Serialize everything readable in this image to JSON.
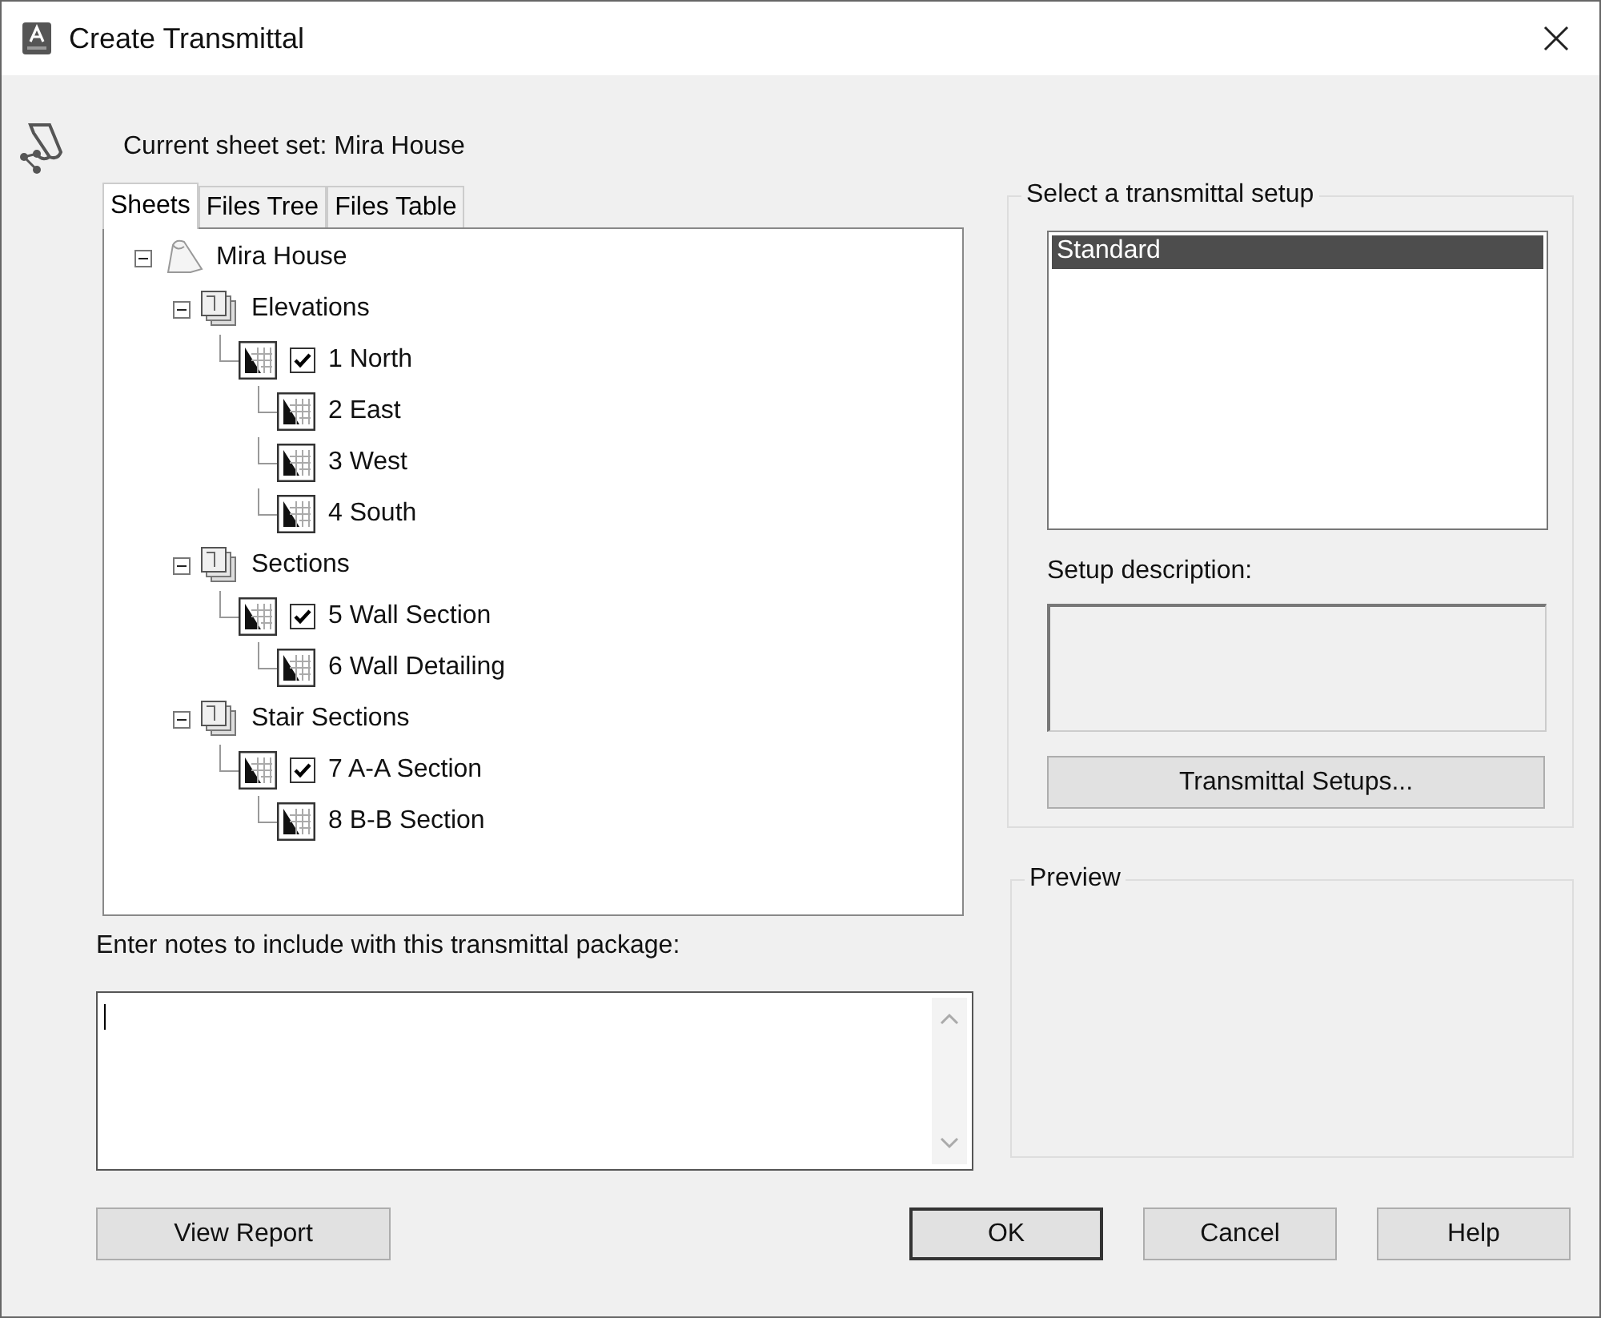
{
  "window": {
    "title": "Create Transmittal"
  },
  "current_sheet_set": "Current sheet set: Mira House",
  "tabs": [
    {
      "label": "Sheets",
      "selected": true
    },
    {
      "label": "Files Tree",
      "selected": false
    },
    {
      "label": "Files Table",
      "selected": false
    }
  ],
  "tree": {
    "root": {
      "label": "Mira House",
      "expanded": true,
      "children": [
        {
          "label": "Elevations",
          "expanded": true,
          "children": [
            {
              "label": "1 North",
              "checked": true,
              "children": [
                {
                  "label": "2 East"
                },
                {
                  "label": "3 West"
                },
                {
                  "label": "4 South"
                }
              ]
            }
          ]
        },
        {
          "label": "Sections",
          "expanded": true,
          "children": [
            {
              "label": "5 Wall Section",
              "checked": true,
              "children": [
                {
                  "label": "6 Wall Detailing"
                }
              ]
            }
          ]
        },
        {
          "label": "Stair Sections",
          "expanded": true,
          "children": [
            {
              "label": "7 A-A Section",
              "checked": true,
              "children": [
                {
                  "label": "8 B-B Section"
                }
              ]
            }
          ]
        }
      ]
    }
  },
  "notes": {
    "label": "Enter notes to include with this transmittal package:"
  },
  "setup": {
    "title": "Select a transmittal setup",
    "items": [
      {
        "label": "Standard",
        "selected": true
      }
    ],
    "description_label": "Setup description:",
    "setups_button": "Transmittal Setups..."
  },
  "preview": {
    "title": "Preview"
  },
  "buttons": {
    "view_report": "View Report",
    "ok": "OK",
    "cancel": "Cancel",
    "help": "Help"
  }
}
